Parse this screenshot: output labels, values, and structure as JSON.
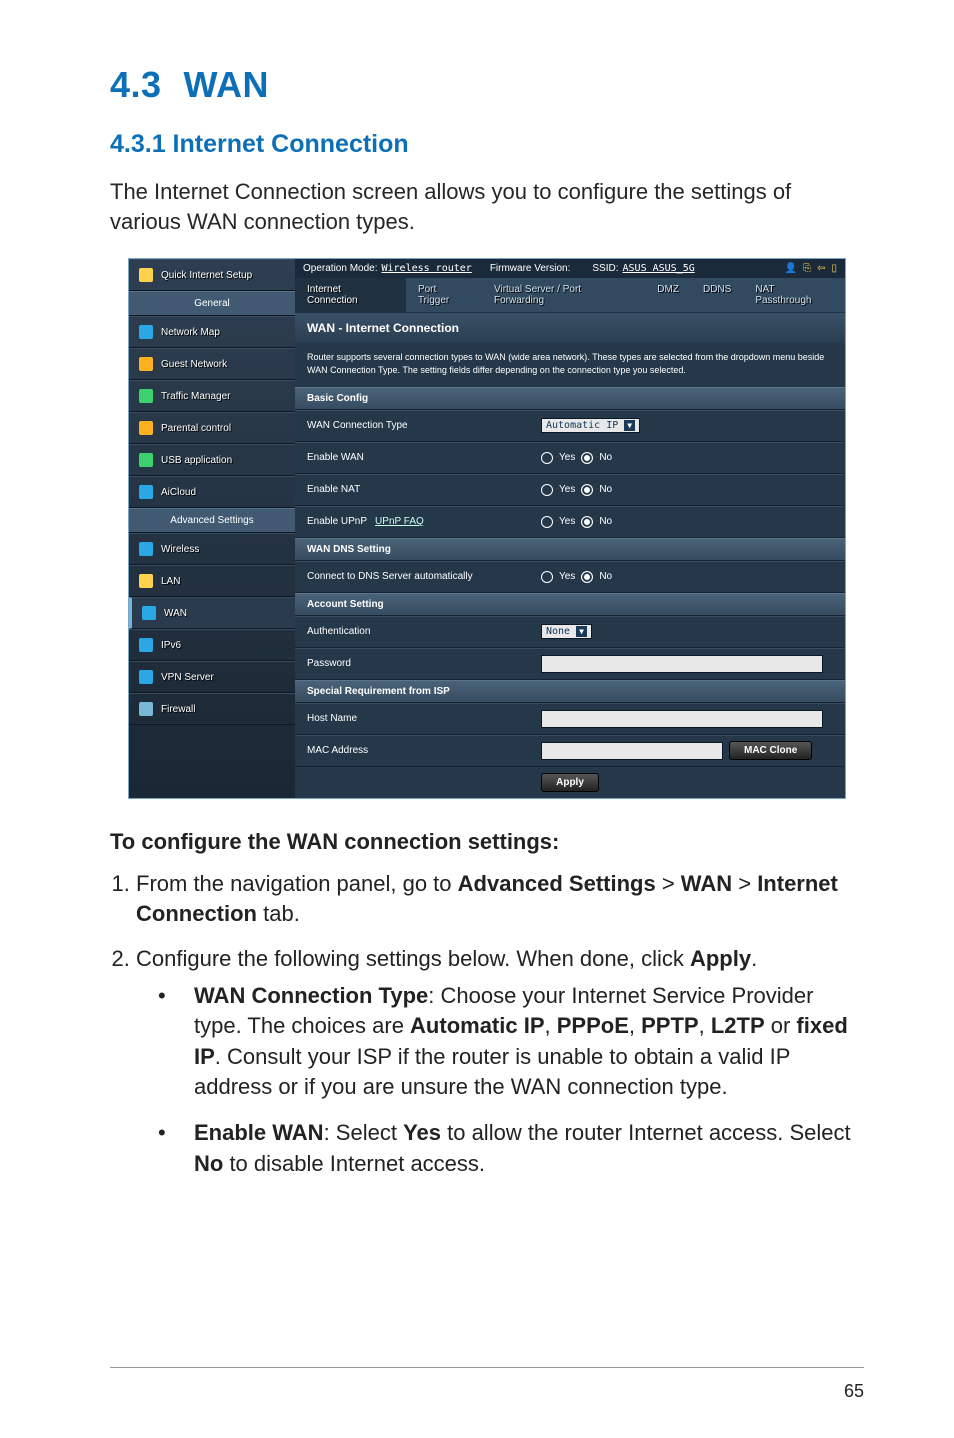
{
  "doc": {
    "section_number": "4.3",
    "section_title": "WAN",
    "subsection": "4.3.1 Internet Connection",
    "intro": "The Internet Connection screen allows you to configure the settings of various WAN connection types.",
    "instr_heading": "To configure the WAN connection settings:",
    "step1_pre": "From the navigation panel, go to ",
    "step1_b1": "Advanced Settings",
    "step1_gt1": " > ",
    "step1_b2": "WAN",
    "step1_gt2": " > ",
    "step1_b3": "Internet Connection",
    "step1_post": " tab.",
    "step2_pre": "Configure the following settings below. When done, click ",
    "step2_b": "Apply",
    "step2_post": ".",
    "bullet1_b": "WAN Connection Type",
    "bullet1_t1": ": Choose your Internet Service Provider type. The choices are ",
    "bullet1_c1": "Automatic IP",
    "bullet1_s1": ", ",
    "bullet1_c2": "PPPoE",
    "bullet1_s2": ", ",
    "bullet1_c3": "PPTP",
    "bullet1_s3": ", ",
    "bullet1_c4": "L2TP",
    "bullet1_s4": " or ",
    "bullet1_c5": "fixed IP",
    "bullet1_t2": ". Consult your ISP if the router is unable to obtain a valid IP address or if you are unsure the WAN connection type.",
    "bullet2_b": "Enable WAN",
    "bullet2_t1": ": Select ",
    "bullet2_yes": "Yes",
    "bullet2_t2": " to allow the router Internet access. Select ",
    "bullet2_no": "No",
    "bullet2_t3": " to disable Internet access.",
    "page_number": "65"
  },
  "ui": {
    "top": {
      "op_mode_label": "Operation Mode:",
      "op_mode_value": "Wireless router",
      "fw_label": "Firmware Version:",
      "ssid_label": "SSID:",
      "ssid_value": "ASUS  ASUS_5G"
    },
    "tabs": {
      "t0": "Internet Connection",
      "t1": "Port Trigger",
      "t2": "Virtual Server / Port Forwarding",
      "t3": "DMZ",
      "t4": "DDNS",
      "t5": "NAT Passthrough"
    },
    "side": {
      "qis": "Quick Internet Setup",
      "general": "General",
      "map": "Network Map",
      "guest": "Guest Network",
      "traf": "Traffic Manager",
      "par": "Parental control",
      "usb": "USB application",
      "aic": "AiCloud",
      "adv": "Advanced Settings",
      "wifi": "Wireless",
      "lan": "LAN",
      "wan": "WAN",
      "ipv6": "IPv6",
      "vpn": "VPN Server",
      "fw": "Firewall"
    },
    "panel": {
      "title": "WAN - Internet Connection",
      "desc": "Router supports several connection types to WAN (wide area network). These types are selected from the dropdown menu beside WAN Connection Type. The setting fields differ depending on the connection type you selected.",
      "basic_h": "Basic Config",
      "wan_type_l": "WAN Connection Type",
      "wan_type_v": "Automatic IP",
      "en_wan_l": "Enable WAN",
      "en_nat_l": "Enable NAT",
      "en_upnp_l": "Enable UPnP",
      "upnp_faq": "UPnP  FAQ",
      "yes": "Yes",
      "no": "No",
      "dns_h": "WAN DNS Setting",
      "dns_l": "Connect to DNS Server automatically",
      "acct_h": "Account Setting",
      "auth_l": "Authentication",
      "auth_v": "None",
      "pwd_l": "Password",
      "isp_h": "Special Requirement from ISP",
      "host_l": "Host Name",
      "mac_l": "MAC Address",
      "mac_btn": "MAC Clone",
      "apply": "Apply"
    }
  }
}
